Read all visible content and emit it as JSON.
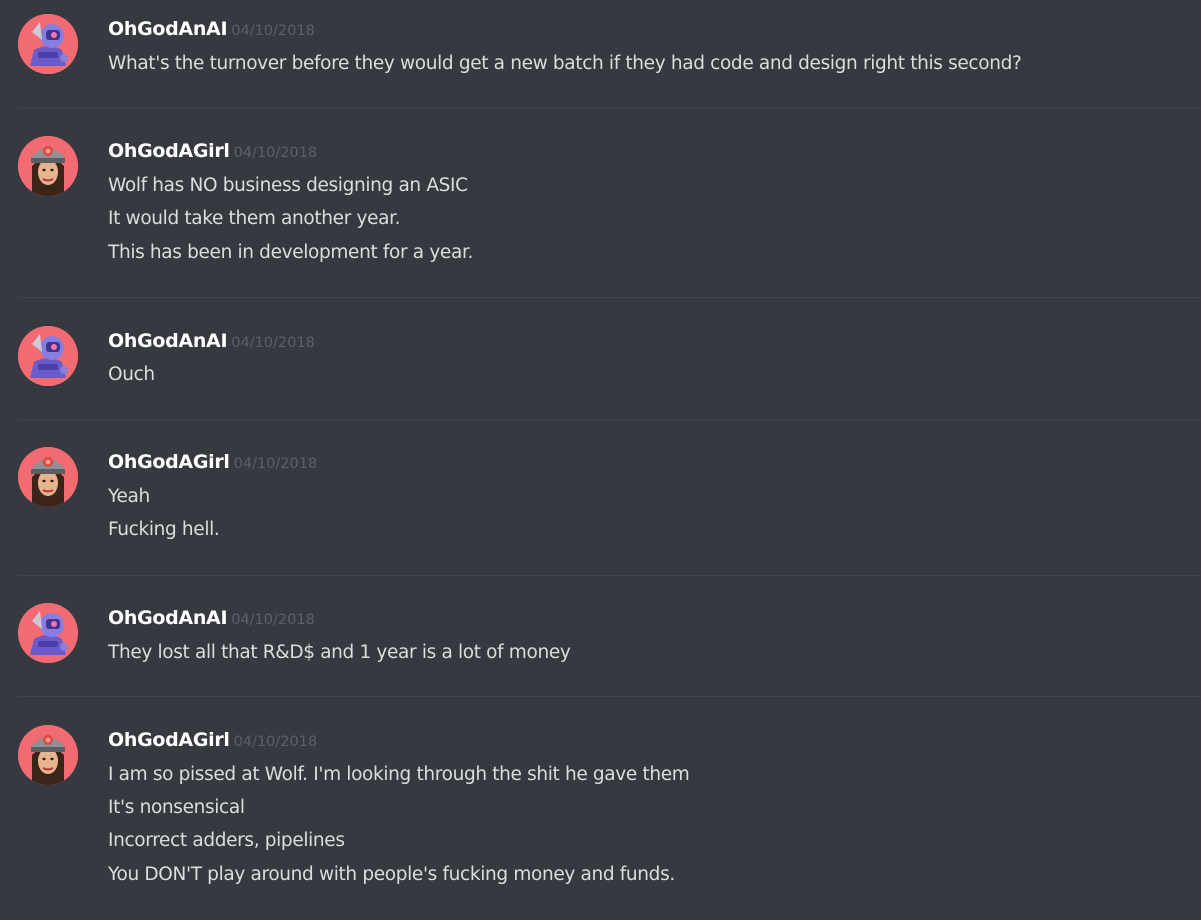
{
  "messages": [
    {
      "author": "OhGodAnAI",
      "avatar": "robot-avatar",
      "timestamp": "04/10/2018",
      "lines": [
        "What's the turnover before they would get a new batch if they had code and design right this second?"
      ]
    },
    {
      "author": "OhGodAGirl",
      "avatar": "girl-avatar",
      "timestamp": "04/10/2018",
      "lines": [
        "Wolf has NO business designing an ASIC",
        "It would take them another year.",
        "This has been in development for a year."
      ]
    },
    {
      "author": "OhGodAnAI",
      "avatar": "robot-avatar",
      "timestamp": "04/10/2018",
      "lines": [
        "Ouch"
      ]
    },
    {
      "author": "OhGodAGirl",
      "avatar": "girl-avatar",
      "timestamp": "04/10/2018",
      "lines": [
        "Yeah",
        "Fucking hell."
      ]
    },
    {
      "author": "OhGodAnAI",
      "avatar": "robot-avatar",
      "timestamp": "04/10/2018",
      "lines": [
        "They lost all that R&D$ and 1 year is a lot of money"
      ]
    },
    {
      "author": "OhGodAGirl",
      "avatar": "girl-avatar",
      "timestamp": "04/10/2018",
      "lines": [
        "I am so pissed at Wolf. I'm looking through the shit he gave them",
        "It's nonsensical",
        "Incorrect adders, pipelines",
        "You DON'T play around with people's fucking money and funds."
      ]
    }
  ],
  "colors": {
    "background": "#36393f",
    "username": "#ffffff",
    "message_text": "#dcddde",
    "timestamp": "#5d6066",
    "avatar_background": "#f26b73"
  }
}
